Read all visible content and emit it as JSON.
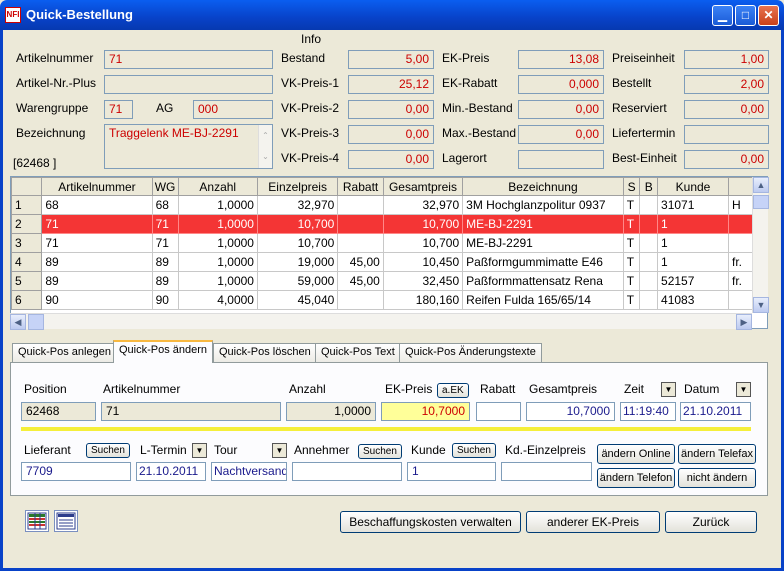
{
  "window": {
    "title": "Quick-Bestellung",
    "icon_text": "NFI"
  },
  "header": {
    "info_label": "Info",
    "artikelnummer": {
      "label": "Artikelnummer",
      "value": "71"
    },
    "artikel_plus": {
      "label": "Artikel-Nr.-Plus",
      "value": ""
    },
    "warengruppe": {
      "label": "Warengruppe",
      "value": "71"
    },
    "ag": {
      "label": "AG",
      "value": "000"
    },
    "bezeichnung": {
      "label": "Bezeichnung",
      "value": "Traggelenk ME-BJ-2291"
    },
    "id_bracket": "[62468           ]",
    "bestand": {
      "label": "Bestand",
      "value": "5,00"
    },
    "vk1": {
      "label": "VK-Preis-1",
      "value": "25,12"
    },
    "vk2": {
      "label": "VK-Preis-2",
      "value": "0,00"
    },
    "vk3": {
      "label": "VK-Preis-3",
      "value": "0,00"
    },
    "vk4": {
      "label": "VK-Preis-4",
      "value": "0,00"
    },
    "ek_preis": {
      "label": "EK-Preis",
      "value": "13,08"
    },
    "ek_rabatt": {
      "label": "EK-Rabatt",
      "value": "0,000"
    },
    "min_bestand": {
      "label": "Min.-Bestand",
      "value": "0,00"
    },
    "max_bestand": {
      "label": "Max.-Bestand",
      "value": "0,00"
    },
    "lagerort": {
      "label": "Lagerort",
      "value": ""
    },
    "preiseinheit": {
      "label": "Preiseinheit",
      "value": "1,00"
    },
    "bestellt": {
      "label": "Bestellt",
      "value": "2,00"
    },
    "reserviert": {
      "label": "Reserviert",
      "value": "0,00"
    },
    "liefertermin": {
      "label": "Liefertermin",
      "value": ""
    },
    "best_einheit": {
      "label": "Best-Einheit",
      "value": "0,00"
    }
  },
  "grid": {
    "columns": [
      "",
      "Artikelnummer",
      "WG",
      "Anzahl",
      "Einzelpreis",
      "Rabatt",
      "Gesamtpreis",
      "Bezeichnung",
      "S",
      "B",
      "Kunde",
      ""
    ],
    "rows": [
      [
        "1",
        "68",
        "68",
        "1,0000",
        "32,970",
        "",
        "32,970",
        "3M Hochglanzpolitur 0937",
        "T",
        "",
        "31071",
        "H"
      ],
      [
        "2",
        "71",
        "71",
        "1,0000",
        "10,700",
        "",
        "10,700",
        "ME-BJ-2291",
        "T",
        "",
        "1",
        ""
      ],
      [
        "3",
        "71",
        "71",
        "1,0000",
        "10,700",
        "",
        "10,700",
        "ME-BJ-2291",
        "T",
        "",
        "1",
        ""
      ],
      [
        "4",
        "89",
        "89",
        "1,0000",
        "19,000",
        "45,00",
        "10,450",
        "Paßformgummimatte E46",
        "T",
        "",
        "1",
        "fr."
      ],
      [
        "5",
        "89",
        "89",
        "1,0000",
        "59,000",
        "45,00",
        "32,450",
        "Paßformmattensatz Rena",
        "T",
        "",
        "52157",
        "fr."
      ],
      [
        "6",
        "90",
        "90",
        "4,0000",
        "45,040",
        "",
        "180,160",
        "Reifen Fulda 165/65/14",
        "T",
        "",
        "41083",
        ""
      ]
    ],
    "selected_row": 1
  },
  "tabs": [
    "Quick-Pos anlegen",
    "Quick-Pos ändern",
    "Quick-Pos löschen",
    "Quick-Pos Text",
    "Quick-Pos Änderungstexte"
  ],
  "edit": {
    "position": {
      "label": "Position",
      "value": "62468"
    },
    "artikelnummer": {
      "label": "Artikelnummer",
      "value": "71"
    },
    "anzahl": {
      "label": "Anzahl",
      "value": "1,0000"
    },
    "ek_preis": {
      "label": "EK-Preis",
      "value": "10,7000",
      "btn": "a.EK"
    },
    "rabatt": {
      "label": "Rabatt",
      "value": ""
    },
    "gesamtpreis": {
      "label": "Gesamtpreis",
      "value": "10,7000"
    },
    "zeit": {
      "label": "Zeit",
      "value": "11:19:40"
    },
    "datum": {
      "label": "Datum",
      "value": "21.10.2011"
    },
    "lieferant": {
      "label": "Lieferant",
      "value": "7709",
      "btn": "Suchen"
    },
    "l_termin": {
      "label": "L-Termin",
      "value": "21.10.2011"
    },
    "tour": {
      "label": "Tour",
      "value": "Nachtversand"
    },
    "annehmer": {
      "label": "Annehmer",
      "value": "",
      "btn": "Suchen"
    },
    "kunde": {
      "label": "Kunde",
      "value": "1",
      "btn": "Suchen"
    },
    "kd_einzelpreis": {
      "label": "Kd.-Einzelpreis",
      "value": ""
    },
    "btn_online": "ändern Online",
    "btn_telefax": "ändern Telefax",
    "btn_telefon": "ändern Telefon",
    "btn_nicht": "nicht ändern"
  },
  "footer": {
    "beschaffung": "Beschaffungskosten verwalten",
    "anderer_ek": "anderer EK-Preis",
    "zurueck": "Zurück"
  },
  "colors": {
    "selected_row": "#f43535",
    "value_red": "#cc0000",
    "highlight_yellow": "#ffff99",
    "title_blue": "#0842c8"
  }
}
